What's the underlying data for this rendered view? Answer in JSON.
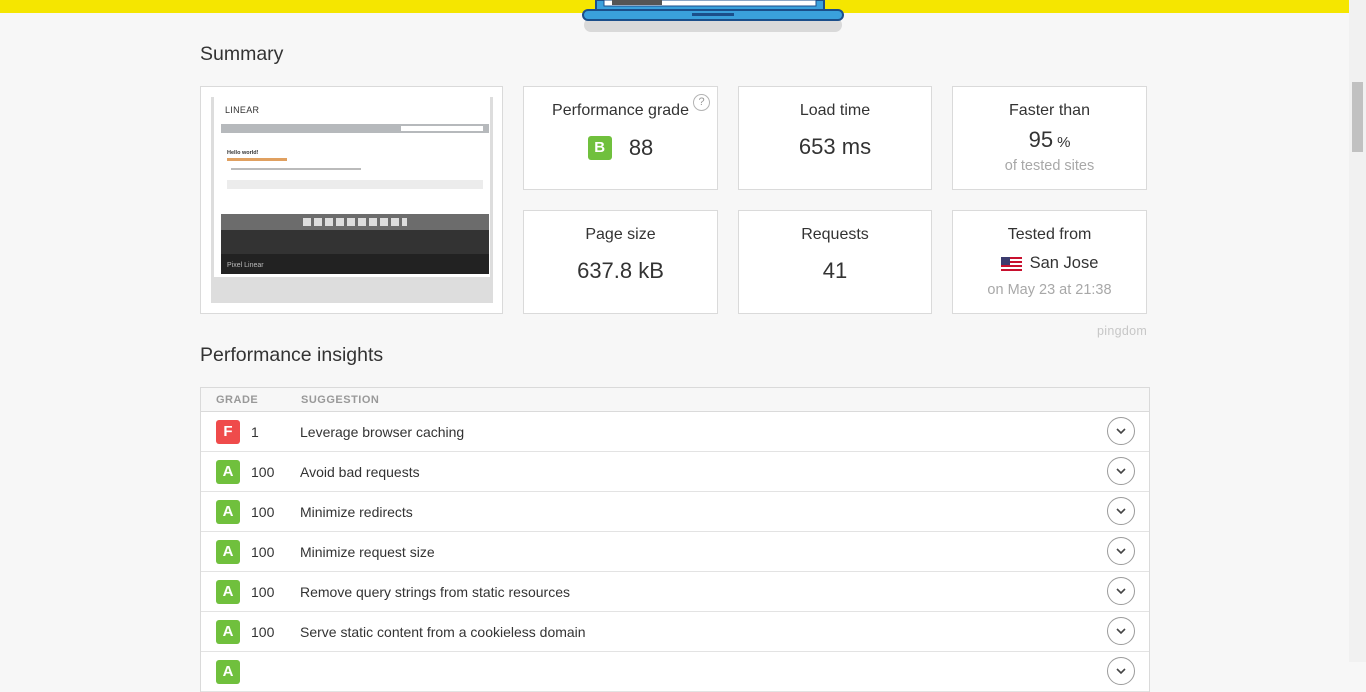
{
  "summary": {
    "title": "Summary",
    "cards": {
      "grade": {
        "label": "Performance grade",
        "letter": "B",
        "value": "88",
        "help": "?"
      },
      "load_time": {
        "label": "Load time",
        "value": "653 ms"
      },
      "faster": {
        "label": "Faster than",
        "value": "95",
        "unit": "%",
        "sub": "of tested sites"
      },
      "page_size": {
        "label": "Page size",
        "value": "637.8 kB"
      },
      "requests": {
        "label": "Requests",
        "value": "41"
      },
      "tested_from": {
        "label": "Tested from",
        "value": "San Jose",
        "sub": "on May 23 at 21:38"
      }
    },
    "thumbnail": {
      "logo": "LINEAR",
      "post_title": "Hello world!",
      "footer_name": "Pixel Linear"
    },
    "brand": "pingdom"
  },
  "insights": {
    "title": "Performance insights",
    "columns": {
      "grade": "GRADE",
      "suggestion": "SUGGESTION"
    },
    "rows": [
      {
        "grade": "F",
        "score": "1",
        "suggestion": "Leverage browser caching"
      },
      {
        "grade": "A",
        "score": "100",
        "suggestion": "Avoid bad requests"
      },
      {
        "grade": "A",
        "score": "100",
        "suggestion": "Minimize redirects"
      },
      {
        "grade": "A",
        "score": "100",
        "suggestion": "Minimize request size"
      },
      {
        "grade": "A",
        "score": "100",
        "suggestion": "Remove query strings from static resources"
      },
      {
        "grade": "A",
        "score": "100",
        "suggestion": "Serve static content from a cookieless domain"
      },
      {
        "grade": "A",
        "score": "",
        "suggestion": ""
      }
    ]
  },
  "colors": {
    "accent_yellow": "#f5e600",
    "grade_good": "#70c03d",
    "grade_bad": "#ef4b4b"
  },
  "icons": {
    "expand": "chevron-down-icon",
    "help": "question-circle-icon",
    "flag": "us-flag-icon"
  }
}
